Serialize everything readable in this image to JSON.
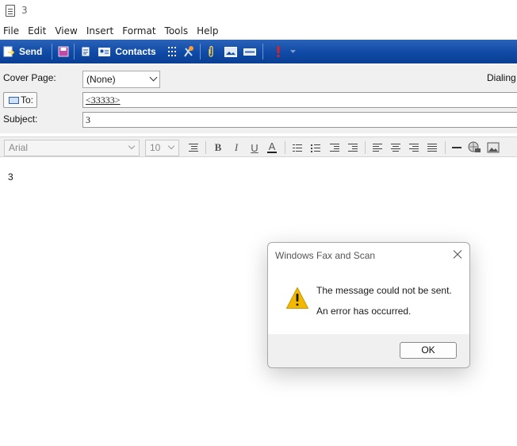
{
  "window": {
    "title": "3"
  },
  "menu": [
    "File",
    "Edit",
    "View",
    "Insert",
    "Format",
    "Tools",
    "Help"
  ],
  "toolbar": {
    "send_label": "Send",
    "contacts_label": "Contacts"
  },
  "form": {
    "cover_page_label": "Cover Page:",
    "cover_page_value": "(None)",
    "dialing_label": "Dialing",
    "to_button_label": "To:",
    "to_value": "<33333>",
    "subject_label": "Subject:",
    "subject_value": "3"
  },
  "format": {
    "font_name": "Arial",
    "font_size": "10"
  },
  "message_body": "3",
  "dialog": {
    "title": "Windows Fax and Scan",
    "message_line1": "The message could not be sent.",
    "message_line2": "An error has occurred.",
    "ok_label": "OK"
  },
  "colors": {
    "toolbar_blue": "#0f4aa6",
    "warning_yellow": "#f2b900",
    "priority_red": "#e02020"
  }
}
